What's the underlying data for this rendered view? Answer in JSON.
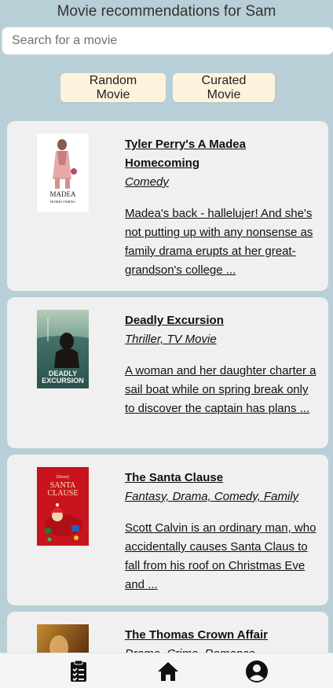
{
  "header": {
    "title": "Movie recommendations for Sam"
  },
  "search": {
    "placeholder": "Search for a movie",
    "value": ""
  },
  "actions": {
    "random_label": "Random Movie",
    "curated_label": "Curated Movie"
  },
  "movies": [
    {
      "title": "Tyler Perry's A Madea Homecoming",
      "genres": "Comedy",
      "description": "Madea's back - hallelujer! And she's not putting up with any nonsense as family drama erupts at her great-grandson's college ...",
      "poster": {
        "caption_1": "MADEA",
        "caption_2": "HOMECOMING"
      }
    },
    {
      "title": "Deadly Excursion",
      "genres": "Thriller, TV Movie",
      "description": "A woman and her daughter charter a sail boat while on spring break only to discover the captain has plans ...",
      "poster": {
        "caption_1": "DEADLY",
        "caption_2": "EXCURSION"
      }
    },
    {
      "title": "The Santa Clause",
      "genres": "Fantasy, Drama, Comedy, Family",
      "description": "Scott Calvin is an ordinary man, who accidentally causes Santa Claus to fall from his roof on Christmas Eve and ...",
      "poster": {
        "caption_0": "Disney",
        "caption_1": "SANTA",
        "caption_2": "CLAUSE"
      }
    },
    {
      "title": "The Thomas Crown Affair",
      "genres": "Drama, Crime, Romance",
      "description": ""
    }
  ],
  "bottom_nav": {
    "items": [
      {
        "icon": "checklist-icon"
      },
      {
        "icon": "home-icon"
      },
      {
        "icon": "account-icon"
      }
    ]
  },
  "colors": {
    "background": "#b9cfd7",
    "card": "#f0f0f0",
    "button": "#fdf3dc",
    "nav": "#f4f5f6"
  }
}
